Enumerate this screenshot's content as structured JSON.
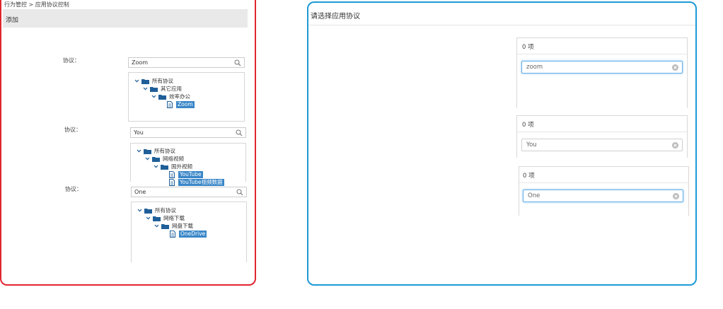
{
  "breadcrumb": "行为管控 > 应用协议控制",
  "add_label": "添加",
  "field_label": "协议：",
  "groups": [
    {
      "search_value": "Zoom",
      "tree": [
        {
          "label": "所有协议",
          "type": "folder",
          "expanded": true
        },
        {
          "label": "其它应用",
          "type": "folder",
          "expanded": true
        },
        {
          "label": "效率办公",
          "type": "folder",
          "expanded": true
        },
        {
          "label": "Zoom",
          "type": "file",
          "selected": true
        }
      ]
    },
    {
      "search_value": "You",
      "tree": [
        {
          "label": "所有协议",
          "type": "folder",
          "expanded": true
        },
        {
          "label": "网络视频",
          "type": "folder",
          "expanded": true
        },
        {
          "label": "国外视频",
          "type": "folder",
          "expanded": true
        },
        {
          "label": "YouTube",
          "type": "file",
          "selected": true
        },
        {
          "label": "YouTube视频数据",
          "type": "file",
          "selected": true
        }
      ]
    },
    {
      "search_value": "One",
      "tree": [
        {
          "label": "所有协议",
          "type": "folder",
          "expanded": true
        },
        {
          "label": "网络下载",
          "type": "folder",
          "expanded": true
        },
        {
          "label": "网盘下载",
          "type": "folder",
          "expanded": true
        },
        {
          "label": "OneDrive",
          "type": "file",
          "selected": true
        }
      ]
    }
  ],
  "right": {
    "title": "请选择应用协议",
    "cards": [
      {
        "count": "0 项",
        "input_value": "zoom",
        "focused": true
      },
      {
        "count": "0 项",
        "input_value": "You",
        "focused": false
      },
      {
        "count": "0 项",
        "input_value": "One",
        "focused": true
      }
    ]
  },
  "colors": {
    "red_border": "#e0262c",
    "blue_border": "#1d9ad6",
    "selection": "#3a87c8",
    "folder": "#1f5f99"
  },
  "icons": [
    "search-icon",
    "chevron-down-icon",
    "folder-icon",
    "file-icon",
    "clear-icon"
  ]
}
